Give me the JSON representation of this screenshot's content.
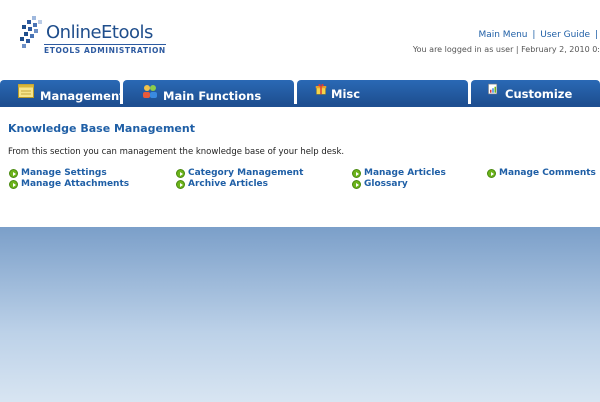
{
  "header": {
    "logo_title": "OnlineEtools",
    "logo_subtitle": "ETOOLS ADMINISTRATION",
    "links": [
      "Main Menu",
      "User Guide"
    ],
    "logged_in_text": "You are logged in as user | February 2, 2010 0:"
  },
  "tabs": [
    {
      "label": "Management",
      "icon": "notepad-icon"
    },
    {
      "label": "Main Functions",
      "icon": "users-icon"
    },
    {
      "label": "Misc",
      "icon": "gift-icon"
    },
    {
      "label": "Customize",
      "icon": "document-chart-icon"
    }
  ],
  "main": {
    "title": "Knowledge Base Management",
    "description": "From this section you can management the knowledge base of your help desk.",
    "links": [
      "Manage Settings",
      "Category Management",
      "Manage Articles",
      "Manage Comments",
      "Manage Attachments",
      "Archive Articles",
      "Glossary"
    ]
  },
  "colors": {
    "tab_blue": "#1e4f91",
    "link_blue": "#1f5fa6",
    "bullet_green": "#6cb31a"
  }
}
